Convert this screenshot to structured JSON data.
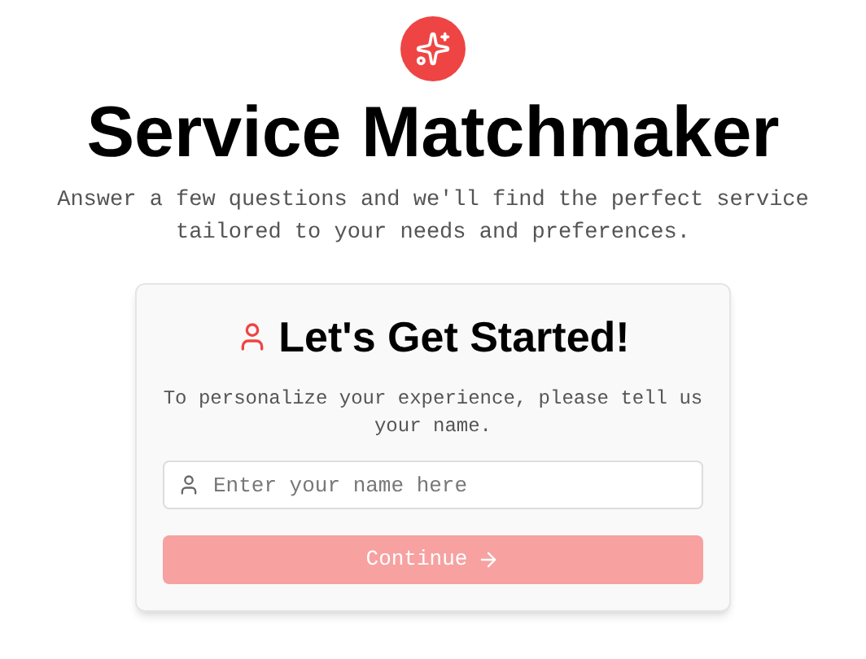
{
  "header": {
    "title": "Service Matchmaker",
    "subtitle": "Answer a few questions and we'll find the perfect service tailored to your needs and preferences."
  },
  "card": {
    "heading": "Let's Get Started!",
    "description": "To personalize your experience, please tell us your name.",
    "name_field": {
      "placeholder": "Enter your name here"
    },
    "button": {
      "label": "Continue",
      "disabled": true
    }
  }
}
